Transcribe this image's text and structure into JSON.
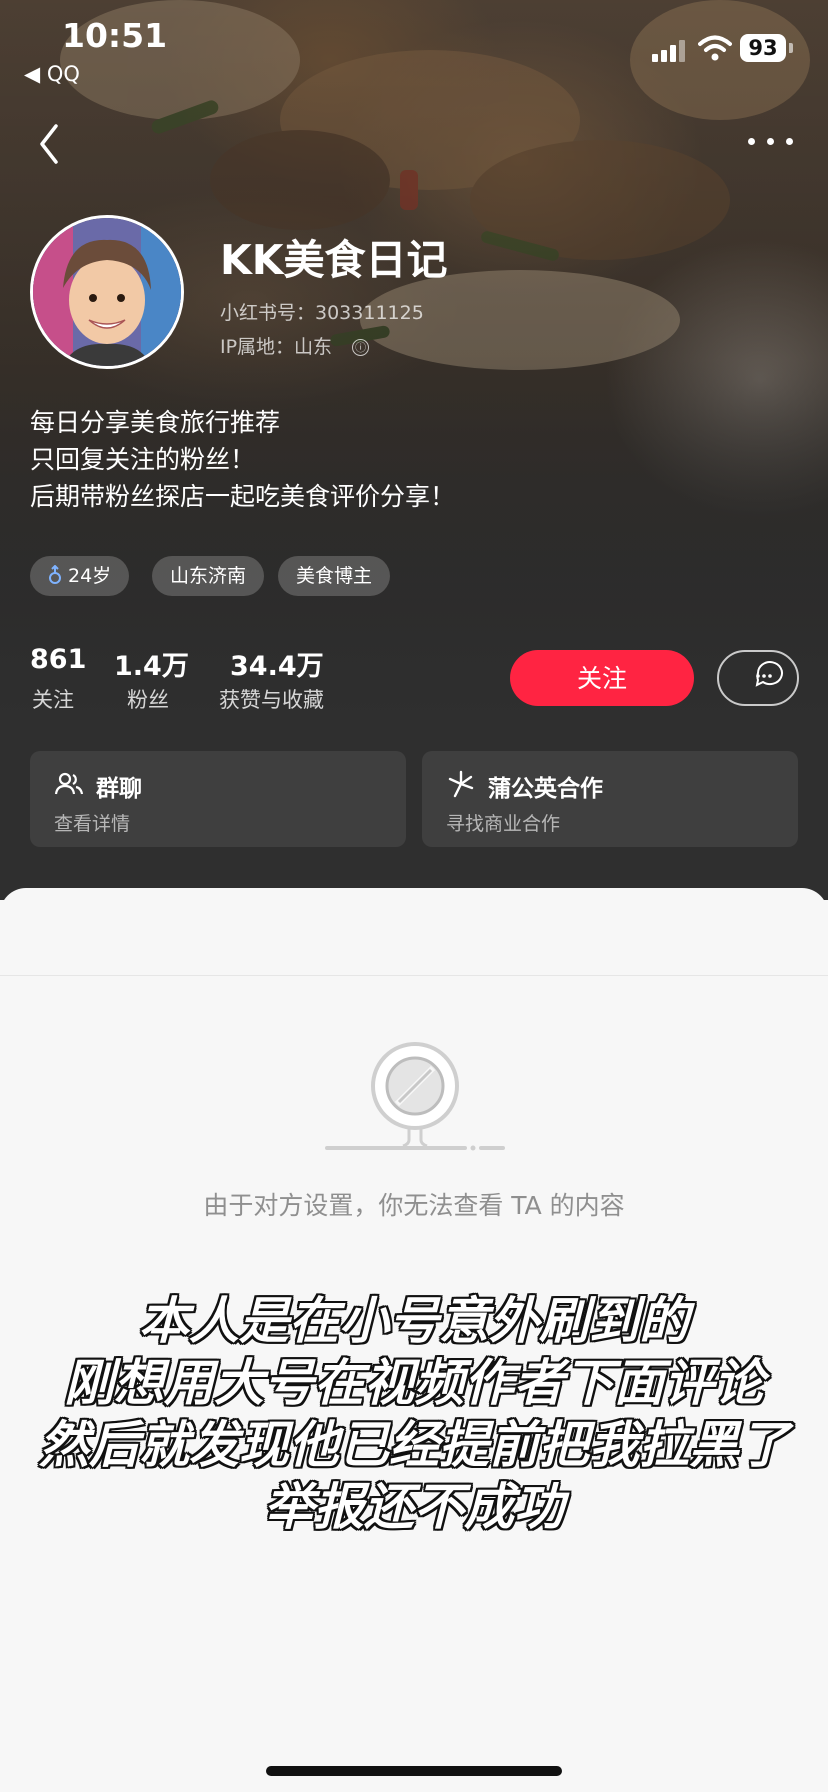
{
  "status_bar": {
    "time": "10:51",
    "back_app": "◀ QQ",
    "battery": "93"
  },
  "profile": {
    "name": "KK美食日记",
    "id_line": "小红书号：303311125",
    "ip_line": "IP属地：山东",
    "info_icon": "ⓘ",
    "bio": [
      "每日分享美食旅行推荐",
      "只回复关注的粉丝！",
      "后期带粉丝探店一起吃美食评价分享！"
    ],
    "tags": [
      "24岁",
      "山东济南",
      "美食博主"
    ],
    "gender_icon": "male-icon"
  },
  "stats": [
    {
      "value": "861",
      "label": "关注"
    },
    {
      "value": "1.4万",
      "label": "粉丝"
    },
    {
      "value": "34.4万",
      "label": "获赞与收藏"
    }
  ],
  "actions": {
    "follow": "关注"
  },
  "cards": [
    {
      "title": "群聊",
      "subtitle": "查看详情",
      "icon": "group-icon"
    },
    {
      "title": "蒲公英合作",
      "subtitle": "寻找商业合作",
      "icon": "dandelion-icon"
    }
  ],
  "empty_state": {
    "message": "由于对方设置，你无法查看 TA 的内容"
  },
  "overlay_caption": [
    "本人是在小号意外刷到的",
    "刚想用大号在视频作者下面评论",
    "然后就发现他已经提前把我拉黑了",
    "举报还不成功"
  ],
  "colors": {
    "accent": "#ff2442",
    "dark_bg": "#2f2f2f"
  }
}
